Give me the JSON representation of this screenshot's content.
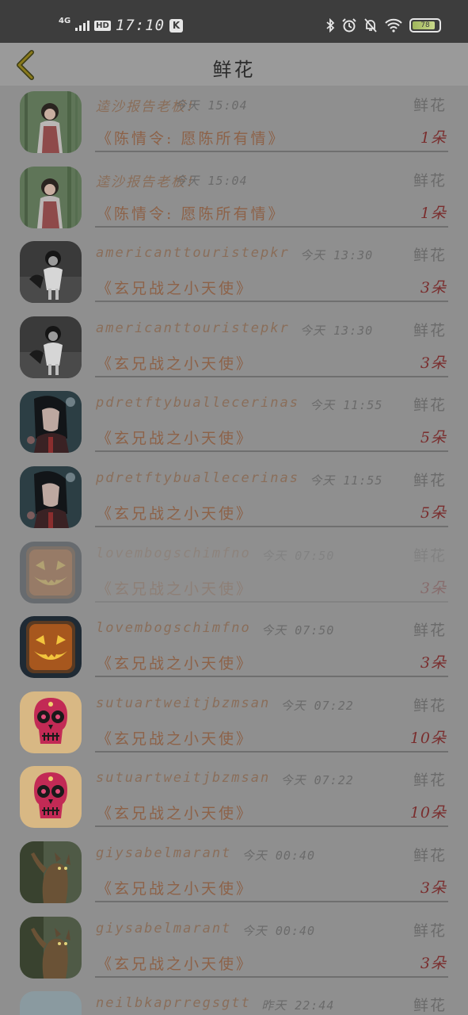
{
  "status_bar": {
    "network": "4G",
    "hd": "HD",
    "time": "17:10",
    "app_badge": "K",
    "battery_level": "78"
  },
  "header": {
    "title": "鲜花"
  },
  "records": [
    {
      "name": "逵沙报告老板!",
      "time": "今天 15:04",
      "gift": "鲜花",
      "work": "《陈情令: 愿陈所有情》",
      "count": "1朵",
      "avatar": "girl-bamboo"
    },
    {
      "name": "逵沙报告老板!",
      "time": "今天 15:04",
      "gift": "鲜花",
      "work": "《陈情令: 愿陈所有情》",
      "count": "1朵",
      "avatar": "girl-bamboo"
    },
    {
      "name": "americanttouristepkr",
      "time": "今天 13:30",
      "gift": "鲜花",
      "work": "《玄兄战之小天使》",
      "count": "3朵",
      "avatar": "monochrome-girl"
    },
    {
      "name": "americanttouristepkr",
      "time": "今天 13:30",
      "gift": "鲜花",
      "work": "《玄兄战之小天使》",
      "count": "3朵",
      "avatar": "monochrome-girl"
    },
    {
      "name": "pdretftybuallecerinas",
      "time": "今天 11:55",
      "gift": "鲜花",
      "work": "《玄兄战之小天使》",
      "count": "5朵",
      "avatar": "anime-girl"
    },
    {
      "name": "pdretftybuallecerinas",
      "time": "今天 11:55",
      "gift": "鲜花",
      "work": "《玄兄战之小天使》",
      "count": "5朵",
      "avatar": "anime-girl"
    },
    {
      "name": "lovembogschimfno",
      "time": "今天 07:50",
      "gift": "鲜花",
      "work": "《玄兄战之小天使》",
      "count": "3朵",
      "avatar": "pumpkin",
      "faded": true
    },
    {
      "name": "lovembogschimfno",
      "time": "今天 07:50",
      "gift": "鲜花",
      "work": "《玄兄战之小天使》",
      "count": "3朵",
      "avatar": "pumpkin"
    },
    {
      "name": "sutuartweitjbzmsan",
      "time": "今天 07:22",
      "gift": "鲜花",
      "work": "《玄兄战之小天使》",
      "count": "10朵",
      "avatar": "sugar-skull"
    },
    {
      "name": "sutuartweitjbzmsan",
      "time": "今天 07:22",
      "gift": "鲜花",
      "work": "《玄兄战之小天使》",
      "count": "10朵",
      "avatar": "sugar-skull"
    },
    {
      "name": "giysabelmarant",
      "time": "今天 00:40",
      "gift": "鲜花",
      "work": "《玄兄战之小天使》",
      "count": "3朵",
      "avatar": "cat"
    },
    {
      "name": "giysabelmarant",
      "time": "今天 00:40",
      "gift": "鲜花",
      "work": "《玄兄战之小天使》",
      "count": "3朵",
      "avatar": "cat"
    },
    {
      "name": "neilbkaprregsgtt",
      "time": "昨天 22:44",
      "gift": "鲜花",
      "work": "",
      "count": "",
      "avatar": "landscape"
    }
  ]
}
